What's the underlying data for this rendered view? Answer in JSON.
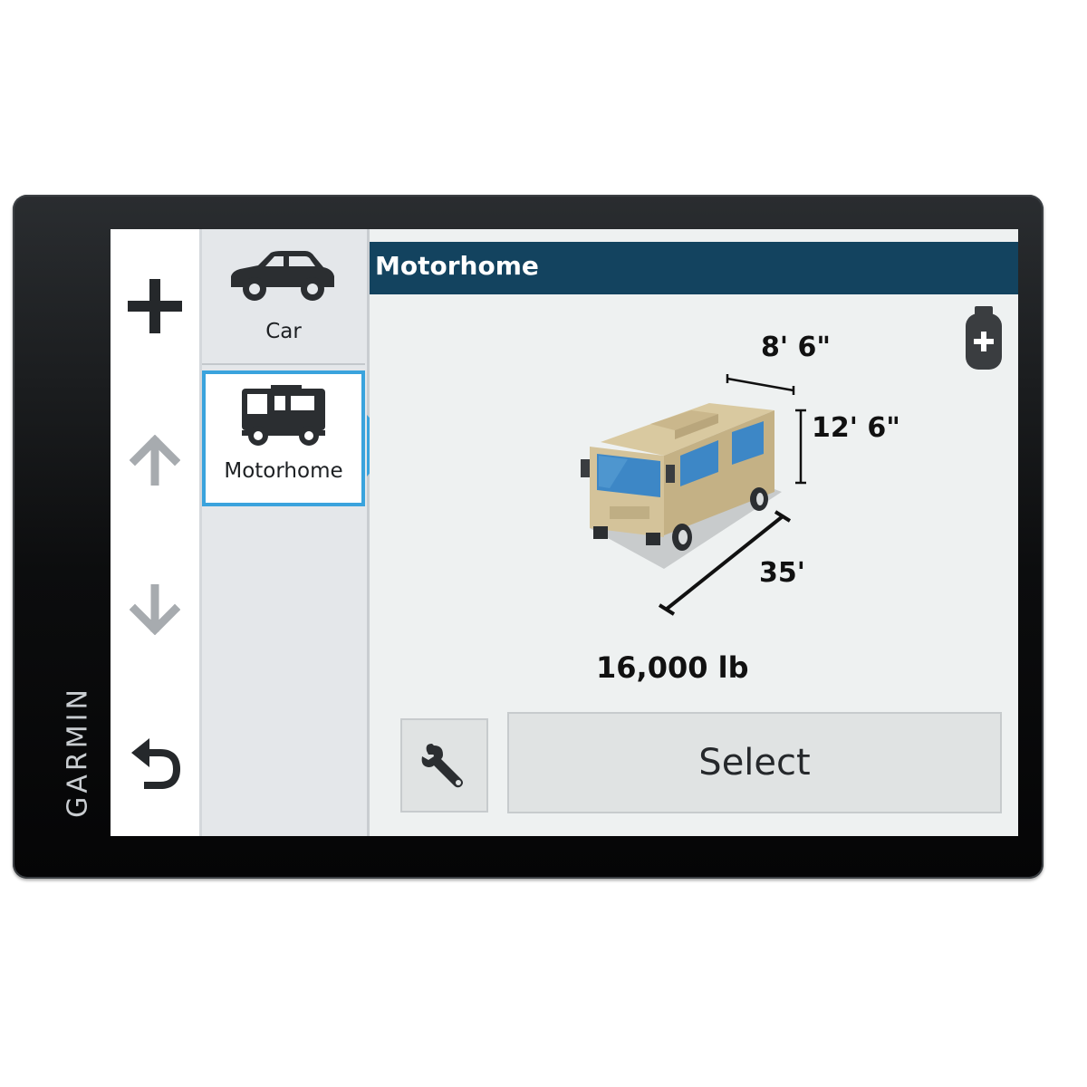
{
  "device": {
    "brand": "GARMIN"
  },
  "rail": {
    "add_icon": "plus-icon",
    "up_icon": "arrow-up-icon",
    "down_icon": "arrow-down-icon",
    "back_icon": "back-arrow-icon"
  },
  "profiles": [
    {
      "label": "Car",
      "icon": "car-icon",
      "selected": false
    },
    {
      "label": "Motorhome",
      "icon": "motorhome-icon",
      "selected": true
    }
  ],
  "header": {
    "title": "Motorhome"
  },
  "vehicle": {
    "width": "8' 6\"",
    "height": "12' 6\"",
    "length": "35'",
    "weight": "16,000  lb",
    "propane_icon": "propane-tank-plus-icon"
  },
  "actions": {
    "settings_icon": "wrench-icon",
    "select_label": "Select"
  },
  "colors": {
    "header_bg": "#13435f",
    "selection_accent": "#3aa3dd",
    "vehicle_body": "#d8c8a0",
    "windows": "#3d87c6"
  }
}
